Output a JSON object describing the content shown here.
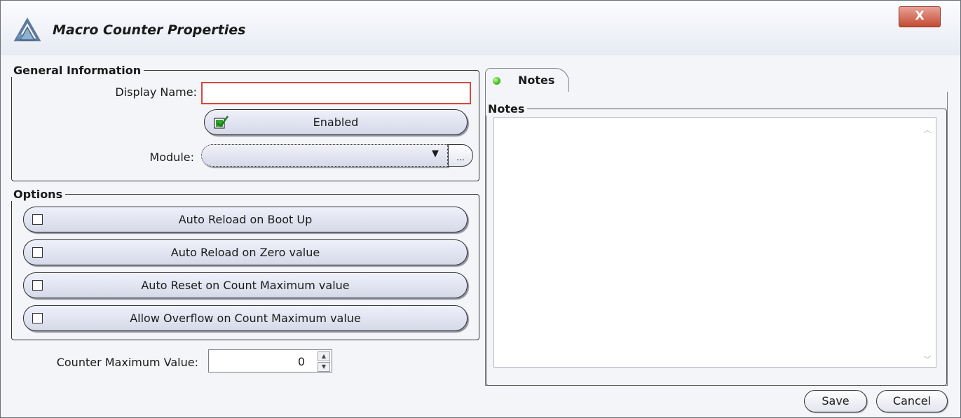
{
  "window": {
    "title": "Macro Counter Properties",
    "close_label": "X"
  },
  "general": {
    "legend": "General Information",
    "display_name_label": "Display Name:",
    "display_name_value": "",
    "enabled_label": "Enabled",
    "enabled_checked": true,
    "module_label": "Module:",
    "module_value": "",
    "module_browse_label": "..."
  },
  "options": {
    "legend": "Options",
    "items": [
      {
        "label": "Auto Reload on Boot Up",
        "checked": false
      },
      {
        "label": "Auto Reload on Zero value",
        "checked": false
      },
      {
        "label": "Auto Reset on Count Maximum value",
        "checked": false
      },
      {
        "label": "Allow Overflow on Count Maximum value",
        "checked": false
      }
    ]
  },
  "counter_max": {
    "label": "Counter Maximum Value:",
    "value": "0"
  },
  "notes": {
    "tab_label": "Notes",
    "group_legend": "Notes",
    "text": ""
  },
  "footer": {
    "save_label": "Save",
    "cancel_label": "Cancel"
  },
  "colors": {
    "required_border": "#d9463a",
    "enabled_check": "#2fa82f",
    "status_dot": "#3fbf1e",
    "close_button": "#c34a33"
  },
  "icons": {
    "app": "macro-triangle-icon",
    "enabled": "checkbox-checked-icon",
    "module_dropdown": "caret-down-icon",
    "status": "status-dot-icon"
  }
}
